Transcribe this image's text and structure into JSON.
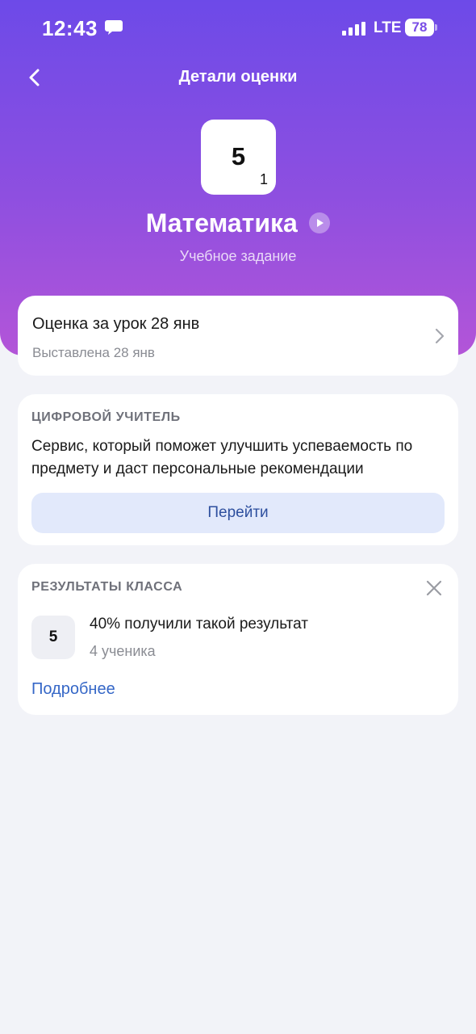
{
  "status_bar": {
    "time": "12:43",
    "network": "LTE",
    "battery": "78"
  },
  "header": {
    "title": "Детали оценки",
    "back_icon": "chevron-left-icon"
  },
  "grade": {
    "value": "5",
    "weight": "1"
  },
  "subject": {
    "name": "Математика",
    "type": "Учебное задание"
  },
  "lesson_card": {
    "title": "Оценка за урок 28 янв",
    "subtitle": "Выставлена 28 янв"
  },
  "digital_teacher": {
    "section_title": "ЦИФРОВОЙ УЧИТЕЛЬ",
    "description": "Сервис, который поможет улучшить успеваемость по предмету и даст персональные рекомендации",
    "button_label": "Перейти"
  },
  "class_results": {
    "section_title": "РЕЗУЛЬТАТЫ КЛАССА",
    "grade": "5",
    "summary": "40% получили такой результат",
    "count": "4 ученика",
    "more_link": "Подробнее"
  },
  "colors": {
    "gradient_top": "#6d4ae8",
    "gradient_bottom": "#b355d8",
    "accent_link": "#3567c7",
    "button_bg": "#e2e9fb",
    "background": "#f2f3f8"
  }
}
